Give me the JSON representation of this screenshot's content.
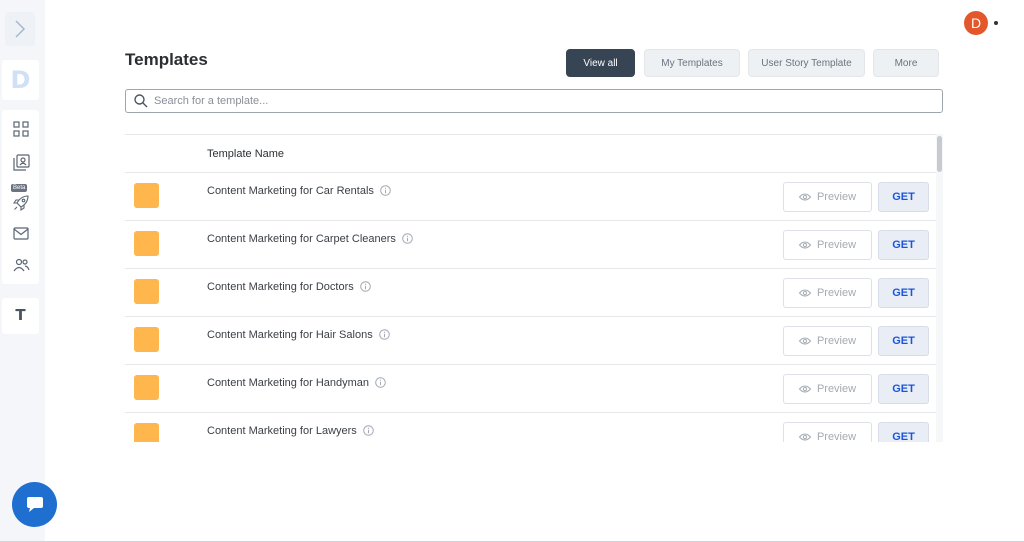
{
  "header": {
    "title": "Templates",
    "filters": [
      {
        "label": "View all",
        "active": true
      },
      {
        "label": "My Templates",
        "active": false
      },
      {
        "label": "User Story Template",
        "active": false
      },
      {
        "label": "More",
        "active": false
      }
    ]
  },
  "user": {
    "initial": "D"
  },
  "sidebar": {
    "logo": "D",
    "beta_label": "Beta",
    "t_label": "T",
    "icons": [
      "expand-icon",
      "grid-icon",
      "contacts-icon",
      "rocket-icon",
      "mail-icon",
      "team-icon"
    ]
  },
  "search": {
    "placeholder": "Search for a template..."
  },
  "table": {
    "column_header": "Template Name",
    "preview_label": "Preview",
    "get_label": "GET",
    "rows": [
      {
        "name": "Content Marketing for Car Rentals"
      },
      {
        "name": "Content Marketing for Carpet Cleaners"
      },
      {
        "name": "Content Marketing for Doctors"
      },
      {
        "name": "Content Marketing for Hair Salons"
      },
      {
        "name": "Content Marketing for Handyman"
      },
      {
        "name": "Content Marketing for Lawyers"
      }
    ]
  },
  "colors": {
    "accent_dark": "#374454",
    "thumb": "#ffb74d",
    "get_text": "#1a56db",
    "avatar": "#e3572a",
    "chat": "#1f6fd1"
  }
}
